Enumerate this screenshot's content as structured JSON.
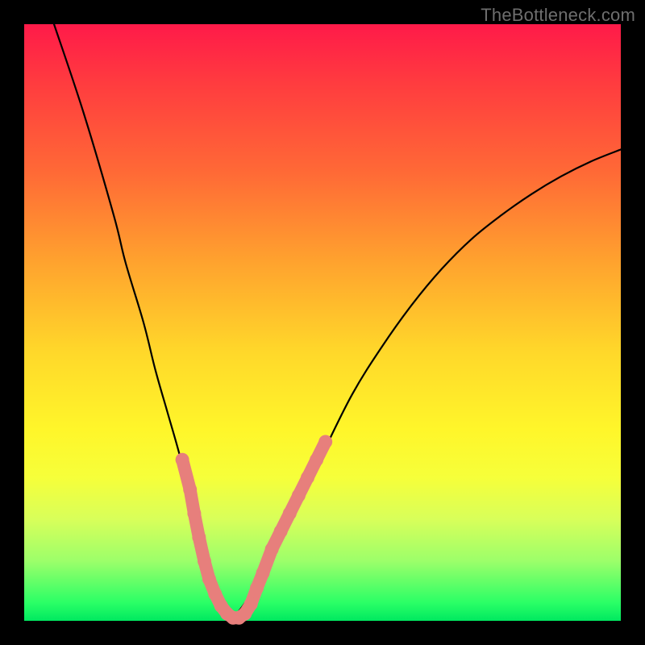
{
  "watermark": "TheBottleneck.com",
  "colors": {
    "curve_stroke": "#000000",
    "marker_fill": "#e77f7c",
    "gradient_top": "#ff1a49",
    "gradient_bottom": "#00e860",
    "frame": "#000000"
  },
  "chart_data": {
    "type": "line",
    "title": "",
    "xlabel": "",
    "ylabel": "",
    "xlim": [
      0,
      100
    ],
    "ylim": [
      0,
      100
    ],
    "series": [
      {
        "name": "left-curve",
        "x": [
          5,
          10,
          15,
          17,
          20,
          22,
          24,
          26,
          28,
          29,
          30,
          31,
          32,
          33,
          34,
          35
        ],
        "values": [
          100,
          85,
          68,
          60,
          50,
          42,
          35,
          28,
          20,
          15,
          11,
          8,
          5,
          3,
          1.5,
          0.5
        ]
      },
      {
        "name": "right-curve",
        "x": [
          35,
          37,
          40,
          43,
          46,
          50,
          55,
          60,
          65,
          70,
          75,
          80,
          85,
          90,
          95,
          100
        ],
        "values": [
          0.5,
          3,
          8,
          14,
          20,
          28,
          38,
          46,
          53,
          59,
          64,
          68,
          71.5,
          74.5,
          77,
          79
        ]
      }
    ],
    "markers": {
      "name": "highlight-points",
      "points": [
        {
          "x": 26.5,
          "y": 27
        },
        {
          "x": 27.8,
          "y": 22
        },
        {
          "x": 28.5,
          "y": 18
        },
        {
          "x": 29.3,
          "y": 14
        },
        {
          "x": 30.2,
          "y": 10
        },
        {
          "x": 31.0,
          "y": 7
        },
        {
          "x": 32.0,
          "y": 4.5
        },
        {
          "x": 33.0,
          "y": 2.5
        },
        {
          "x": 34.0,
          "y": 1.2
        },
        {
          "x": 35.0,
          "y": 0.5
        },
        {
          "x": 36.0,
          "y": 0.5
        },
        {
          "x": 37.0,
          "y": 1.2
        },
        {
          "x": 38.0,
          "y": 2.8
        },
        {
          "x": 39.0,
          "y": 5.5
        },
        {
          "x": 40.0,
          "y": 8
        },
        {
          "x": 41.5,
          "y": 12
        },
        {
          "x": 43.0,
          "y": 15
        },
        {
          "x": 44.5,
          "y": 18
        },
        {
          "x": 46.0,
          "y": 21
        },
        {
          "x": 47.5,
          "y": 24
        },
        {
          "x": 49.0,
          "y": 27
        },
        {
          "x": 50.5,
          "y": 30
        }
      ]
    }
  }
}
